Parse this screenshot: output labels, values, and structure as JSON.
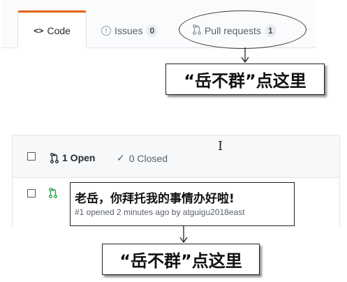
{
  "repo_tabs": {
    "code": {
      "label": "Code",
      "icon": "code-icon"
    },
    "issues": {
      "label": "Issues",
      "count": "0",
      "icon": "issue-opened-icon"
    },
    "pulls": {
      "label": "Pull requests",
      "count": "1",
      "icon": "git-pull-request-icon"
    }
  },
  "annotations": {
    "top_callout": "“岳不群”点这里",
    "bottom_callout": "“岳不群”点这里"
  },
  "issue_list": {
    "open_label": "1 Open",
    "closed_label": "0 Closed",
    "rows": [
      {
        "title": "老岳，你拜托我的事情办好啦!",
        "meta": "#1 opened 2 minutes ago by atguigu2018east"
      }
    ]
  },
  "colors": {
    "active_tab_accent": "#e36209",
    "pr_open_green": "#28a745",
    "muted_text": "#586069"
  }
}
